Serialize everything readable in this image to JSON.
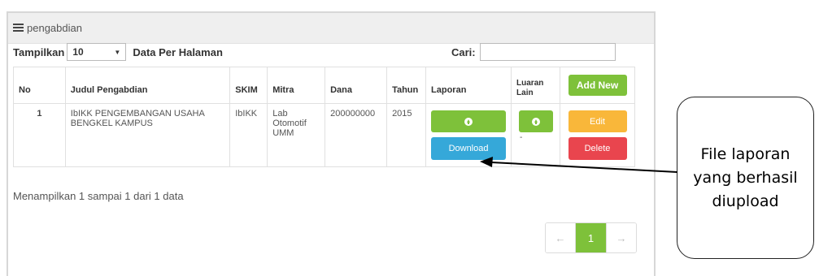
{
  "panel": {
    "title": "pengabdian"
  },
  "controls": {
    "show_label": "Tampilkan",
    "page_size": "10",
    "per_page_label": "Data Per Halaman",
    "search_label": "Cari:",
    "search_value": ""
  },
  "table": {
    "headers": {
      "no": "No",
      "judul": "Judul Pengabdian",
      "skim": "SKIM",
      "mitra": "Mitra",
      "dana": "Dana",
      "tahun": "Tahun",
      "laporan": "Laporan",
      "luaran_1": "Luaran",
      "luaran_2": "Lain",
      "add": "Add New"
    },
    "rows": [
      {
        "no": "1",
        "judul": "IbIKK PENGEMBANGAN USAHA BENGKEL KAMPUS",
        "skim": "IbIKK",
        "mitra": "Lab Otomotif UMM",
        "dana": "200000000",
        "tahun": "2015",
        "download_label": "Download",
        "luaran_value": "-",
        "edit_label": "Edit",
        "delete_label": "Delete"
      }
    ]
  },
  "info": "Menampilkan 1 sampai 1 dari 1 data",
  "pagination": {
    "prev": "←",
    "current": "1",
    "next": "→"
  },
  "callout": {
    "text": "File laporan yang berhasil diupload"
  },
  "icons": {
    "upload": "circle-arrow-up-icon",
    "list": "list-icon"
  },
  "colors": {
    "green": "#7ec13a",
    "blue": "#35a8d9",
    "orange": "#f9b73a",
    "red": "#e9454e"
  }
}
